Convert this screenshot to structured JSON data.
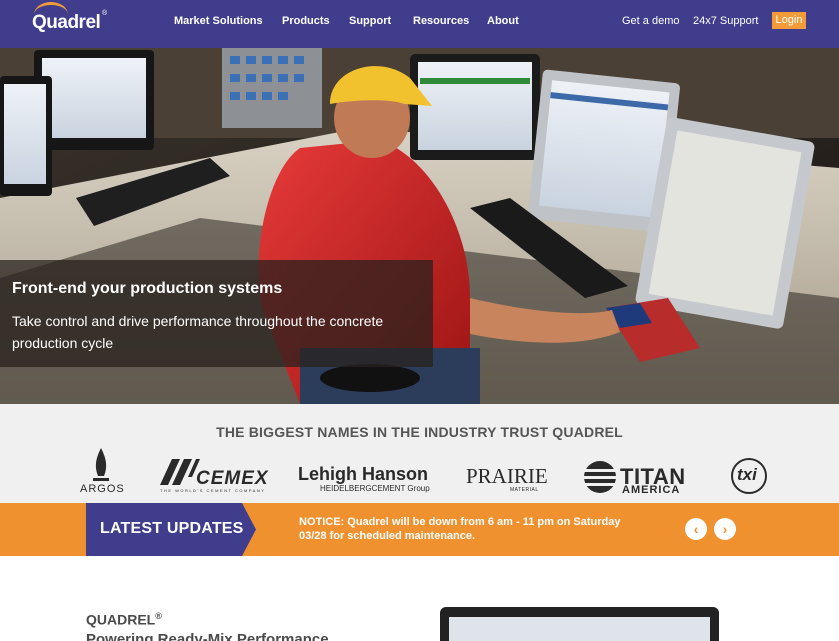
{
  "nav": {
    "logo": "Quadrel",
    "logo_reg": "®",
    "items": [
      "Market Solutions",
      "Products",
      "Support",
      "Resources",
      "About"
    ],
    "demo": "Get a demo",
    "support": "24x7 Support",
    "login": "Login"
  },
  "hero": {
    "title": "Front-end your production systems",
    "subtitle": "Take control and drive performance throughout the concrete production cycle"
  },
  "trust": {
    "heading": "THE BIGGEST NAMES IN THE INDUSTRY TRUST QUADREL",
    "brands": {
      "argos": "ARGOS",
      "cemex": "CEMEX",
      "cemex_tag": "THE WORLD'S CEMENT COMPANY",
      "lehigh": "Lehigh Hanson",
      "lehigh_sub": "HEIDELBERGCEMENT Group",
      "prairie": "PRAIRIE",
      "prairie_sub": "MATERIAL",
      "titan": "TITAN",
      "titan_sub": "AMERICA",
      "txi": "txi"
    }
  },
  "updates": {
    "label": "LATEST UPDATES",
    "notice": "NOTICE: Quadrel will be down from 6 am - 11 pm on Saturday 03/28 for scheduled maintenance.",
    "prev_icon": "‹",
    "next_icon": "›"
  },
  "intro": {
    "title": "QUADREL",
    "title_reg": "®",
    "subtitle": "Powering Ready-Mix Performance"
  },
  "colors": {
    "nav_bg": "#3f3d8c",
    "accent_orange": "#f0912f",
    "updates_tab": "#3f3d8c",
    "trust_bg": "#f0f0f0"
  }
}
